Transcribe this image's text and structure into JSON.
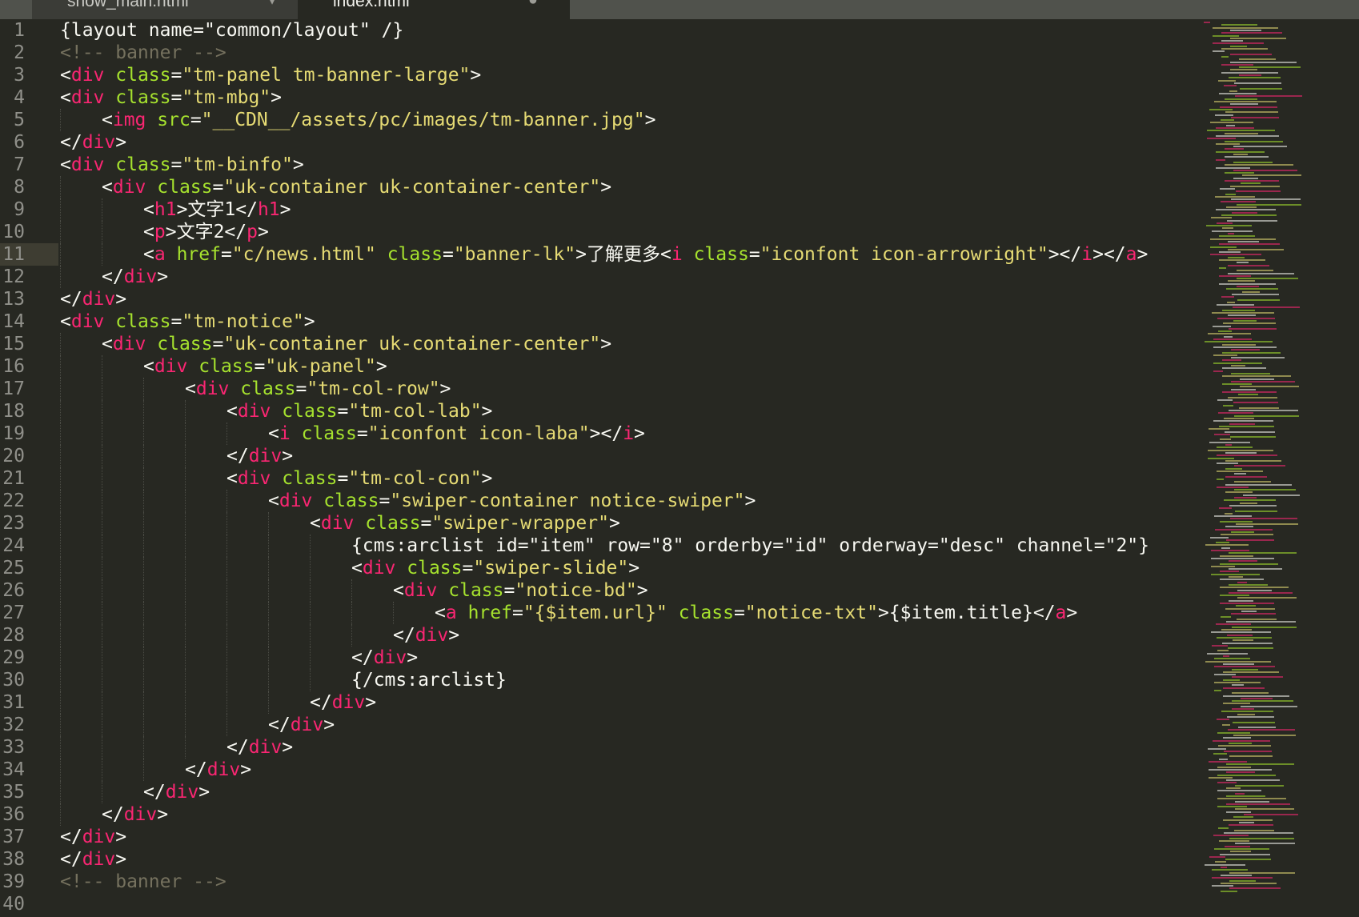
{
  "tabs": [
    {
      "label": "show_main.html",
      "close_glyph": "▾",
      "active": false
    },
    {
      "label": "index.html",
      "close_glyph": "●",
      "active": true
    }
  ],
  "current_line": 11,
  "colors": {
    "background": "#272822",
    "tag": "#f92672",
    "attribute": "#a6e22e",
    "string": "#e6db74",
    "comment": "#75715e",
    "text": "#f8f8f2",
    "line_number": "#90908a"
  },
  "lines": [
    {
      "n": "1",
      "i": 0,
      "t": [
        [
          "p",
          "{layout name=\"common/layout\" /}"
        ]
      ]
    },
    {
      "n": "2",
      "i": 0,
      "t": [
        [
          "c",
          "<!-- banner -->"
        ]
      ]
    },
    {
      "n": "3",
      "i": 0,
      "t": [
        [
          "p",
          "<"
        ],
        [
          "t",
          "div"
        ],
        [
          "p",
          " "
        ],
        [
          "a",
          "class"
        ],
        [
          "p",
          "="
        ],
        [
          "s",
          "\"tm-panel tm-banner-large\""
        ],
        [
          "p",
          ">"
        ]
      ]
    },
    {
      "n": "4",
      "i": 0,
      "t": [
        [
          "p",
          "<"
        ],
        [
          "t",
          "div"
        ],
        [
          "p",
          " "
        ],
        [
          "a",
          "class"
        ],
        [
          "p",
          "="
        ],
        [
          "s",
          "\"tm-mbg\""
        ],
        [
          "p",
          ">"
        ]
      ]
    },
    {
      "n": "5",
      "i": 1,
      "t": [
        [
          "p",
          "<"
        ],
        [
          "t",
          "img"
        ],
        [
          "p",
          " "
        ],
        [
          "a",
          "src"
        ],
        [
          "p",
          "="
        ],
        [
          "s",
          "\"__CDN__/assets/pc/images/tm-banner.jpg\""
        ],
        [
          "p",
          ">"
        ]
      ]
    },
    {
      "n": "6",
      "i": 0,
      "t": [
        [
          "p",
          "</"
        ],
        [
          "t",
          "div"
        ],
        [
          "p",
          ">"
        ]
      ]
    },
    {
      "n": "7",
      "i": 0,
      "t": [
        [
          "p",
          "<"
        ],
        [
          "t",
          "div"
        ],
        [
          "p",
          " "
        ],
        [
          "a",
          "class"
        ],
        [
          "p",
          "="
        ],
        [
          "s",
          "\"tm-binfo\""
        ],
        [
          "p",
          ">"
        ]
      ]
    },
    {
      "n": "8",
      "i": 1,
      "t": [
        [
          "p",
          "<"
        ],
        [
          "t",
          "div"
        ],
        [
          "p",
          " "
        ],
        [
          "a",
          "class"
        ],
        [
          "p",
          "="
        ],
        [
          "s",
          "\"uk-container uk-container-center\""
        ],
        [
          "p",
          ">"
        ]
      ]
    },
    {
      "n": "9",
      "i": 2,
      "t": [
        [
          "p",
          "<"
        ],
        [
          "t",
          "h1"
        ],
        [
          "p",
          ">文字1</"
        ],
        [
          "t",
          "h1"
        ],
        [
          "p",
          ">"
        ]
      ]
    },
    {
      "n": "10",
      "i": 2,
      "t": [
        [
          "p",
          "<"
        ],
        [
          "t",
          "p"
        ],
        [
          "p",
          ">文字2</"
        ],
        [
          "t",
          "p"
        ],
        [
          "p",
          ">"
        ]
      ]
    },
    {
      "n": "11",
      "i": 2,
      "t": [
        [
          "p",
          "<"
        ],
        [
          "t",
          "a"
        ],
        [
          "p",
          " "
        ],
        [
          "a",
          "href"
        ],
        [
          "p",
          "="
        ],
        [
          "s",
          "\"c/news.html\""
        ],
        [
          "p",
          " "
        ],
        [
          "a",
          "class"
        ],
        [
          "p",
          "="
        ],
        [
          "s",
          "\"banner-lk\""
        ],
        [
          "p",
          ">了解更多<"
        ],
        [
          "t",
          "i"
        ],
        [
          "p",
          " "
        ],
        [
          "a",
          "class"
        ],
        [
          "p",
          "="
        ],
        [
          "s",
          "\"iconfont icon-arrowright\""
        ],
        [
          "p",
          "></"
        ],
        [
          "t",
          "i"
        ],
        [
          "p",
          "></"
        ],
        [
          "t",
          "a"
        ],
        [
          "p",
          ">"
        ]
      ]
    },
    {
      "n": "12",
      "i": 1,
      "t": [
        [
          "p",
          "</"
        ],
        [
          "t",
          "div"
        ],
        [
          "p",
          ">"
        ]
      ]
    },
    {
      "n": "13",
      "i": 0,
      "t": [
        [
          "p",
          "</"
        ],
        [
          "t",
          "div"
        ],
        [
          "p",
          ">"
        ]
      ]
    },
    {
      "n": "14",
      "i": 0,
      "t": [
        [
          "p",
          "<"
        ],
        [
          "t",
          "div"
        ],
        [
          "p",
          " "
        ],
        [
          "a",
          "class"
        ],
        [
          "p",
          "="
        ],
        [
          "s",
          "\"tm-notice\""
        ],
        [
          "p",
          ">"
        ]
      ]
    },
    {
      "n": "15",
      "i": 1,
      "t": [
        [
          "p",
          "<"
        ],
        [
          "t",
          "div"
        ],
        [
          "p",
          " "
        ],
        [
          "a",
          "class"
        ],
        [
          "p",
          "="
        ],
        [
          "s",
          "\"uk-container uk-container-center\""
        ],
        [
          "p",
          ">"
        ]
      ]
    },
    {
      "n": "16",
      "i": 2,
      "t": [
        [
          "p",
          "<"
        ],
        [
          "t",
          "div"
        ],
        [
          "p",
          " "
        ],
        [
          "a",
          "class"
        ],
        [
          "p",
          "="
        ],
        [
          "s",
          "\"uk-panel\""
        ],
        [
          "p",
          ">"
        ]
      ]
    },
    {
      "n": "17",
      "i": 3,
      "t": [
        [
          "p",
          "<"
        ],
        [
          "t",
          "div"
        ],
        [
          "p",
          " "
        ],
        [
          "a",
          "class"
        ],
        [
          "p",
          "="
        ],
        [
          "s",
          "\"tm-col-row\""
        ],
        [
          "p",
          ">"
        ]
      ]
    },
    {
      "n": "18",
      "i": 4,
      "t": [
        [
          "p",
          "<"
        ],
        [
          "t",
          "div"
        ],
        [
          "p",
          " "
        ],
        [
          "a",
          "class"
        ],
        [
          "p",
          "="
        ],
        [
          "s",
          "\"tm-col-lab\""
        ],
        [
          "p",
          ">"
        ]
      ]
    },
    {
      "n": "19",
      "i": 5,
      "t": [
        [
          "p",
          "<"
        ],
        [
          "t",
          "i"
        ],
        [
          "p",
          " "
        ],
        [
          "a",
          "class"
        ],
        [
          "p",
          "="
        ],
        [
          "s",
          "\"iconfont icon-laba\""
        ],
        [
          "p",
          "></"
        ],
        [
          "t",
          "i"
        ],
        [
          "p",
          ">"
        ]
      ]
    },
    {
      "n": "20",
      "i": 4,
      "t": [
        [
          "p",
          "</"
        ],
        [
          "t",
          "div"
        ],
        [
          "p",
          ">"
        ]
      ]
    },
    {
      "n": "21",
      "i": 4,
      "t": [
        [
          "p",
          "<"
        ],
        [
          "t",
          "div"
        ],
        [
          "p",
          " "
        ],
        [
          "a",
          "class"
        ],
        [
          "p",
          "="
        ],
        [
          "s",
          "\"tm-col-con\""
        ],
        [
          "p",
          ">"
        ]
      ]
    },
    {
      "n": "22",
      "i": 5,
      "t": [
        [
          "p",
          "<"
        ],
        [
          "t",
          "div"
        ],
        [
          "p",
          " "
        ],
        [
          "a",
          "class"
        ],
        [
          "p",
          "="
        ],
        [
          "s",
          "\"swiper-container notice-swiper\""
        ],
        [
          "p",
          ">"
        ]
      ]
    },
    {
      "n": "23",
      "i": 6,
      "t": [
        [
          "p",
          "<"
        ],
        [
          "t",
          "div"
        ],
        [
          "p",
          " "
        ],
        [
          "a",
          "class"
        ],
        [
          "p",
          "="
        ],
        [
          "s",
          "\"swiper-wrapper\""
        ],
        [
          "p",
          ">"
        ]
      ]
    },
    {
      "n": "24",
      "i": 7,
      "t": [
        [
          "p",
          "{cms:arclist id=\"item\" row=\"8\" orderby=\"id\" orderway=\"desc\" channel=\"2\"}"
        ]
      ]
    },
    {
      "n": "25",
      "i": 7,
      "t": [
        [
          "p",
          "<"
        ],
        [
          "t",
          "div"
        ],
        [
          "p",
          " "
        ],
        [
          "a",
          "class"
        ],
        [
          "p",
          "="
        ],
        [
          "s",
          "\"swiper-slide\""
        ],
        [
          "p",
          ">"
        ]
      ]
    },
    {
      "n": "26",
      "i": 8,
      "t": [
        [
          "p",
          "<"
        ],
        [
          "t",
          "div"
        ],
        [
          "p",
          " "
        ],
        [
          "a",
          "class"
        ],
        [
          "p",
          "="
        ],
        [
          "s",
          "\"notice-bd\""
        ],
        [
          "p",
          ">"
        ]
      ]
    },
    {
      "n": "27",
      "i": 9,
      "t": [
        [
          "p",
          "<"
        ],
        [
          "t",
          "a"
        ],
        [
          "p",
          " "
        ],
        [
          "a",
          "href"
        ],
        [
          "p",
          "="
        ],
        [
          "s",
          "\"{$item.url}\""
        ],
        [
          "p",
          " "
        ],
        [
          "a",
          "class"
        ],
        [
          "p",
          "="
        ],
        [
          "s",
          "\"notice-txt\""
        ],
        [
          "p",
          ">{$item.title}</"
        ],
        [
          "t",
          "a"
        ],
        [
          "p",
          ">"
        ]
      ]
    },
    {
      "n": "28",
      "i": 8,
      "t": [
        [
          "p",
          "</"
        ],
        [
          "t",
          "div"
        ],
        [
          "p",
          ">"
        ]
      ]
    },
    {
      "n": "29",
      "i": 7,
      "t": [
        [
          "p",
          "</"
        ],
        [
          "t",
          "div"
        ],
        [
          "p",
          ">"
        ]
      ]
    },
    {
      "n": "30",
      "i": 7,
      "t": [
        [
          "p",
          "{/cms:arclist}"
        ]
      ]
    },
    {
      "n": "31",
      "i": 6,
      "t": [
        [
          "p",
          "</"
        ],
        [
          "t",
          "div"
        ],
        [
          "p",
          ">"
        ]
      ]
    },
    {
      "n": "32",
      "i": 5,
      "t": [
        [
          "p",
          "</"
        ],
        [
          "t",
          "div"
        ],
        [
          "p",
          ">"
        ]
      ]
    },
    {
      "n": "33",
      "i": 4,
      "t": [
        [
          "p",
          "</"
        ],
        [
          "t",
          "div"
        ],
        [
          "p",
          ">"
        ]
      ]
    },
    {
      "n": "34",
      "i": 3,
      "t": [
        [
          "p",
          "</"
        ],
        [
          "t",
          "div"
        ],
        [
          "p",
          ">"
        ]
      ]
    },
    {
      "n": "35",
      "i": 2,
      "t": [
        [
          "p",
          "</"
        ],
        [
          "t",
          "div"
        ],
        [
          "p",
          ">"
        ]
      ]
    },
    {
      "n": "36",
      "i": 1,
      "t": [
        [
          "p",
          "</"
        ],
        [
          "t",
          "div"
        ],
        [
          "p",
          ">"
        ]
      ]
    },
    {
      "n": "37",
      "i": 0,
      "t": [
        [
          "p",
          "</"
        ],
        [
          "t",
          "div"
        ],
        [
          "p",
          ">"
        ]
      ]
    },
    {
      "n": "38",
      "i": 0,
      "t": [
        [
          "p",
          "</"
        ],
        [
          "t",
          "div"
        ],
        [
          "p",
          ">"
        ]
      ]
    },
    {
      "n": "39",
      "i": 0,
      "t": [
        [
          "c",
          "<!-- banner -->"
        ]
      ]
    },
    {
      "n": "40",
      "i": 0,
      "t": []
    }
  ]
}
